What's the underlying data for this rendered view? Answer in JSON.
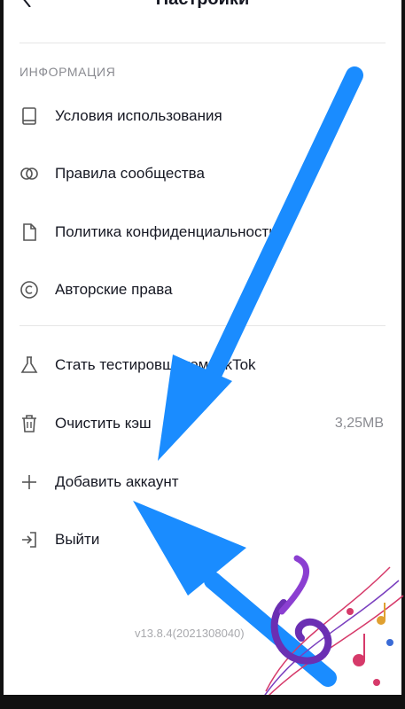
{
  "header": {
    "title": "Настройки"
  },
  "section": {
    "label": "ИНФОРМАЦИЯ"
  },
  "items": [
    {
      "label": "Условия использования",
      "icon": "book-icon"
    },
    {
      "label": "Правила сообщества",
      "icon": "community-icon"
    },
    {
      "label": "Политика конфиденциальности",
      "icon": "document-icon"
    },
    {
      "label": "Авторские права",
      "icon": "copyright-icon"
    },
    {
      "label": "Стать тестировщиком TikTok",
      "icon": "flask-icon"
    },
    {
      "label": "Очистить кэш",
      "value": "3,25MB",
      "icon": "trash-icon"
    },
    {
      "label": "Добавить аккаунт",
      "icon": "plus-icon"
    },
    {
      "label": "Выйти",
      "icon": "logout-icon"
    }
  ],
  "version": "v13.8.4(2021308040)",
  "colors": {
    "arrow": "#1a8cff",
    "text": "#161823",
    "muted": "#8a8b91"
  }
}
